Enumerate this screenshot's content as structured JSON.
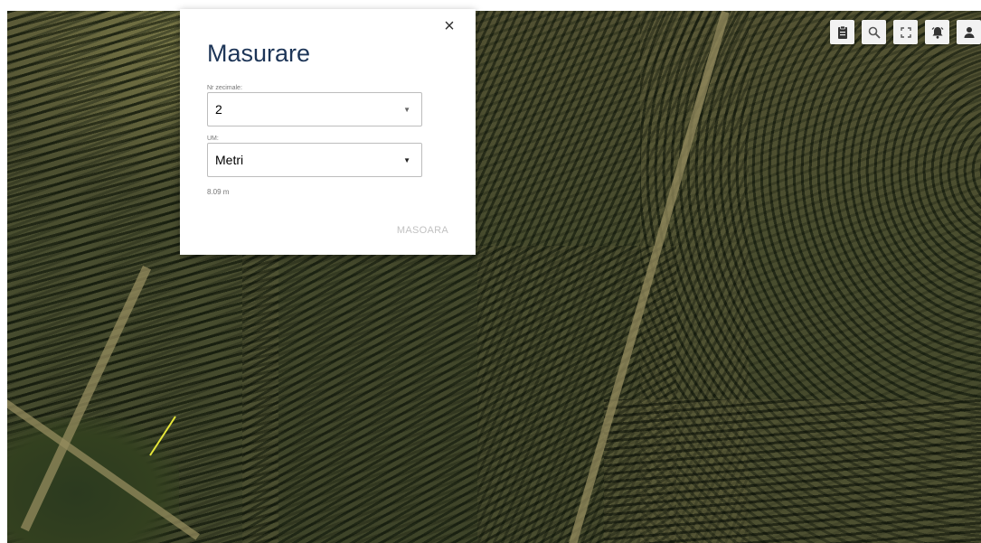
{
  "dialog": {
    "title": "Masurare",
    "close_symbol": "×",
    "fields": [
      {
        "label": "Nr zecimale:",
        "value": "2",
        "arrow": "▼"
      },
      {
        "label": "UM:",
        "value": "Metri",
        "arrow": "▼"
      }
    ],
    "result_text": "8.09 m",
    "measure_label": "MASOARA"
  },
  "toolbar": {
    "buttons": [
      {
        "name": "clipboard-button",
        "icon": "clipboard-icon"
      },
      {
        "name": "search-button",
        "icon": "search-icon"
      },
      {
        "name": "fullscreen-button",
        "icon": "fullscreen-icon"
      },
      {
        "name": "notifications-button",
        "icon": "bell-icon"
      },
      {
        "name": "user-button",
        "icon": "user-icon"
      }
    ]
  },
  "colors": {
    "title": "#1d3557",
    "measure_line": "#e6e63a",
    "disabled_text": "#c2c2c2",
    "toolbar_bg": "#f2f2f2"
  }
}
